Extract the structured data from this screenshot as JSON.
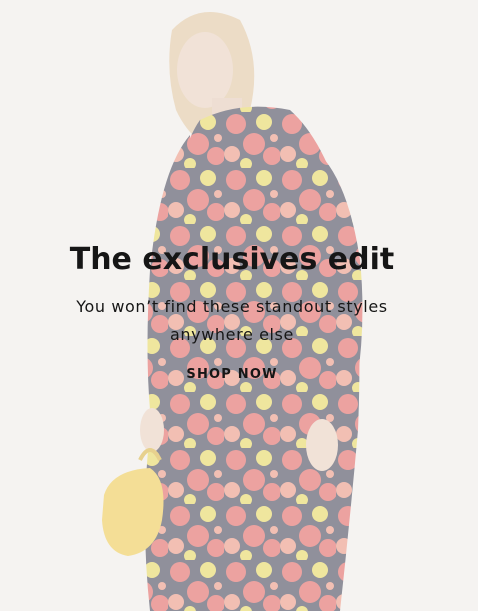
{
  "banner": {
    "headline": "The exclusives edit",
    "subtext": "You won’t find these standout styles anywhere else",
    "cta_label": "SHOP NOW"
  },
  "colors": {
    "text": "#161616",
    "background": "#f4f2f0",
    "dress_red": "#e2514e",
    "dress_yellow": "#e9d94a",
    "dress_navy": "#2a2c45",
    "bag_yellow": "#f2c93a"
  }
}
